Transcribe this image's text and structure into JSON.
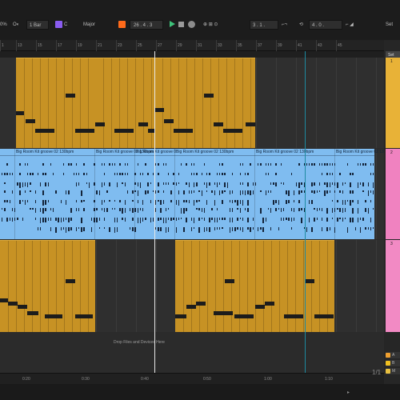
{
  "transport": {
    "zoom": "0%",
    "follow_icon": "follow-icon",
    "quantize": "1 Bar",
    "key": "C",
    "scale": "Major",
    "position": "26 .  4 .  3",
    "loop_start": "3 .  1 .",
    "loop_length": "4 .  0 .",
    "set_label": "Set",
    "colors": {
      "scale_chip": "#8a5cf0",
      "arrange_chip": "#ff6a1a",
      "play": "#3ec27a"
    }
  },
  "ruler": {
    "bars": [
      "1",
      "13",
      "15",
      "17",
      "19",
      "21",
      "23",
      "25",
      "27",
      "29",
      "31",
      "33",
      "35",
      "37",
      "39",
      "41",
      "43",
      "45"
    ]
  },
  "tracks": [
    {
      "name": "1",
      "type": "midi",
      "color": "#c79224"
    },
    {
      "name": "2",
      "type": "audio",
      "color": "#7fbcf0",
      "clips": [
        "Big Room Kit groove 02  130bpm",
        "Big Room Kit groove 02  130bpm",
        "Big Room Kit groove 0",
        "Big Room Kit groove 02  130bpm",
        "Big Room Kit groove 02  130bpm",
        "Big Room Kit groove 02  130bpm",
        "Big Room Kit groove 02  130bpm"
      ]
    },
    {
      "name": "3",
      "type": "midi",
      "color": "#c79224"
    }
  ],
  "drop_hint": "Drop Files and Devices Here",
  "time_ruler": [
    "0:20",
    "0:30",
    "0:40",
    "0:50",
    "1:00",
    "1:10"
  ],
  "returns": [
    {
      "label": "A",
      "color": "#f0a030"
    },
    {
      "label": "B",
      "color": "#f0c020"
    },
    {
      "label": "M",
      "color": "#e8c040"
    }
  ],
  "page_count": "1/1",
  "status_icon": "chevron-right-icon"
}
